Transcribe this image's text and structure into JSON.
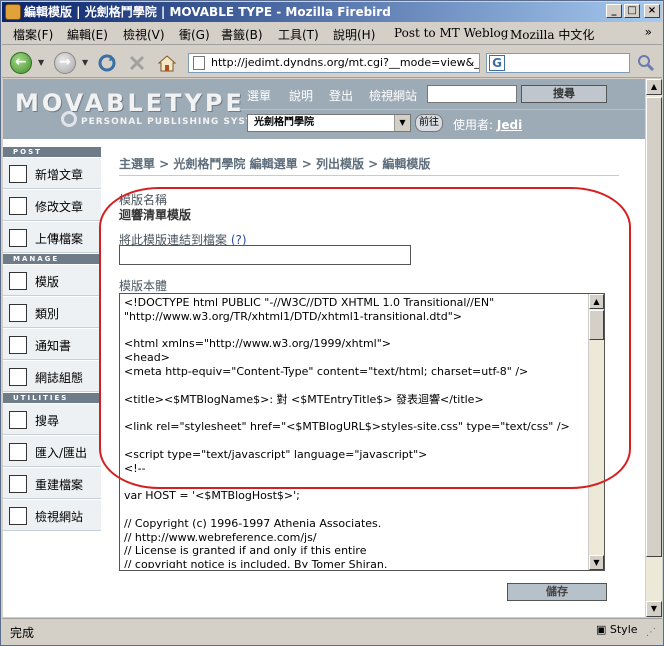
{
  "window": {
    "title": "編輯模版 | 光劍格鬥學院 | MOVABLE TYPE - Mozilla Firebird",
    "min": "_",
    "max": "□",
    "close": "×"
  },
  "menu": {
    "items": [
      "檔案(F)",
      "編輯(E)",
      "檢視(V)",
      "衝(G)",
      "書籤(B)",
      "工具(T)",
      "說明(H)",
      "Post to MT Weblog",
      "Mozilla 中文化"
    ],
    "more": "»"
  },
  "navbar": {
    "url": "http://jedimt.dyndns.org/mt.cgi?__mode=view&_typ"
  },
  "mt": {
    "logo": "MOVABLETYPE",
    "tagline": "PERSONAL PUBLISHING SYSTEM",
    "nav": [
      "選單",
      "說明",
      "登出",
      "檢視網站"
    ],
    "search_button": "搜尋",
    "blog_select": "光劍格鬥學院",
    "go_button": "前往",
    "user_label": "使用者:",
    "user_name": "Jedi"
  },
  "sidebar": {
    "sections": [
      {
        "head": "POST",
        "items": [
          "新增文章",
          "修改文章",
          "上傳檔案"
        ]
      },
      {
        "head": "MANAGE",
        "items": [
          "模版",
          "類別",
          "通知書",
          "網誌組態"
        ]
      },
      {
        "head": "UTILITIES",
        "items": [
          "搜尋",
          "匯入/匯出",
          "重建檔案",
          "檢視網站"
        ]
      }
    ]
  },
  "main": {
    "breadcrumb": "主選單 > 光劍格鬥學院 編輯選單 > 列出模版 > 編輯模版",
    "template_name_label": "模版名稱",
    "template_name_value": "迴響清單模版",
    "link_label": "將此模版連結到檔案",
    "link_help": "(?)",
    "body_label": "模版本體",
    "body_lines": [
      "<!DOCTYPE html PUBLIC \"-//W3C//DTD XHTML 1.0 Transitional//EN\"",
      "\"http://www.w3.org/TR/xhtml1/DTD/xhtml1-transitional.dtd\">",
      "",
      "<html xmlns=\"http://www.w3.org/1999/xhtml\">",
      "<head>",
      "<meta http-equiv=\"Content-Type\" content=\"text/html; charset=utf-8\" />",
      "",
      "<title><$MTBlogName$>: 對 <$MTEntryTitle$> 發表迴響</title>",
      "",
      "<link rel=\"stylesheet\" href=\"<$MTBlogURL$>styles-site.css\" type=\"text/css\" />",
      "",
      "<script type=\"text/javascript\" language=\"javascript\">",
      "<!--",
      "",
      "var HOST = '<$MTBlogHost$>';",
      "",
      "// Copyright (c) 1996-1997 Athenia Associates.",
      "// http://www.webreference.com/js/",
      "// License is granted if and only if this entire",
      "// copyright notice is included. By Tomer Shiran."
    ],
    "save_button": "儲存"
  },
  "status": {
    "text": "完成",
    "style": "Style"
  }
}
